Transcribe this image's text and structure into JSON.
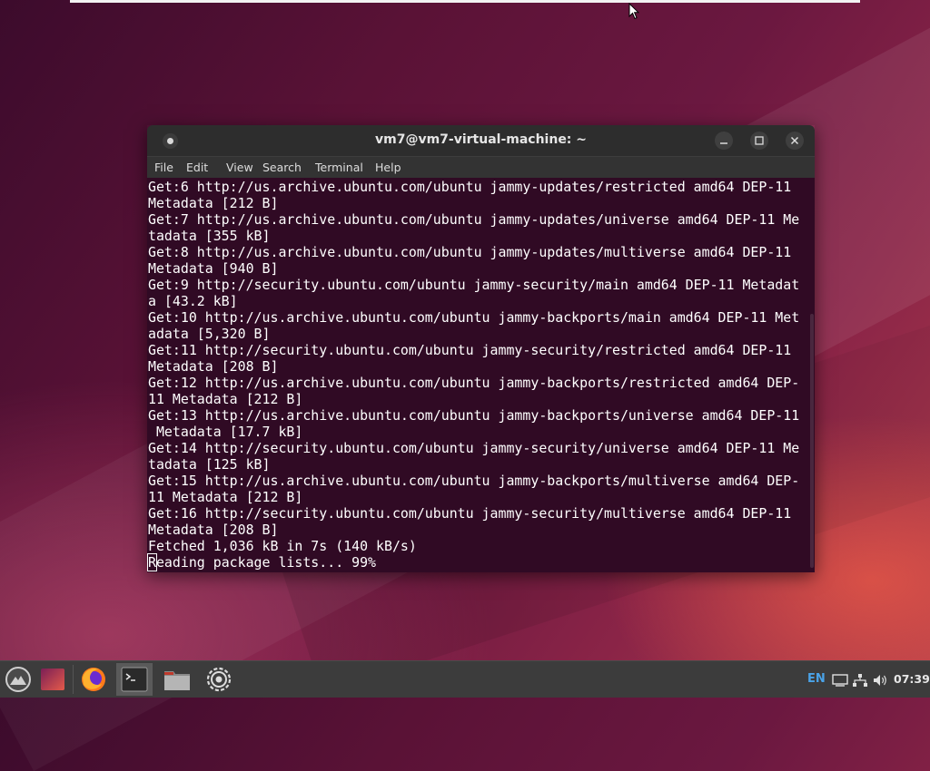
{
  "terminal": {
    "title": "vm7@vm7-virtual-machine: ~",
    "menu": [
      "File",
      "Edit",
      "View",
      "Search",
      "Terminal",
      "Help"
    ],
    "lines": [
      "Get:6 http://us.archive.ubuntu.com/ubuntu jammy-updates/restricted amd64 DEP-11",
      "Metadata [212 B]",
      "Get:7 http://us.archive.ubuntu.com/ubuntu jammy-updates/universe amd64 DEP-11 Me",
      "tadata [355 kB]",
      "Get:8 http://us.archive.ubuntu.com/ubuntu jammy-updates/multiverse amd64 DEP-11",
      "Metadata [940 B]",
      "Get:9 http://security.ubuntu.com/ubuntu jammy-security/main amd64 DEP-11 Metadat",
      "a [43.2 kB]",
      "Get:10 http://us.archive.ubuntu.com/ubuntu jammy-backports/main amd64 DEP-11 Met",
      "adata [5,320 B]",
      "Get:11 http://security.ubuntu.com/ubuntu jammy-security/restricted amd64 DEP-11",
      "Metadata [208 B]",
      "Get:12 http://us.archive.ubuntu.com/ubuntu jammy-backports/restricted amd64 DEP-",
      "11 Metadata [212 B]",
      "Get:13 http://us.archive.ubuntu.com/ubuntu jammy-backports/universe amd64 DEP-11",
      " Metadata [17.7 kB]",
      "Get:14 http://security.ubuntu.com/ubuntu jammy-security/universe amd64 DEP-11 Me",
      "tadata [125 kB]",
      "Get:15 http://us.archive.ubuntu.com/ubuntu jammy-backports/multiverse amd64 DEP-",
      "11 Metadata [212 B]",
      "Get:16 http://security.ubuntu.com/ubuntu jammy-security/multiverse amd64 DEP-11",
      "Metadata [208 B]",
      "Fetched 1,036 kB in 7s (140 kB/s)"
    ],
    "prompt_line": {
      "cursor_char": "R",
      "rest": "eading package lists... 99%"
    },
    "colors": {
      "background": "#300a24",
      "text": "#ffffff",
      "titlebar": "#2d2d2d"
    }
  },
  "taskbar": {
    "apps": [
      {
        "name": "app-menu",
        "icon": "mountain-logo-icon"
      },
      {
        "name": "show-desktop",
        "icon": "desktop-icon"
      },
      {
        "name": "firefox",
        "icon": "firefox-icon"
      },
      {
        "name": "terminal",
        "icon": "terminal-icon"
      },
      {
        "name": "files",
        "icon": "folder-icon"
      },
      {
        "name": "settings",
        "icon": "gear-icon"
      }
    ],
    "tray": {
      "language": "EN",
      "time": "07:39",
      "icons": [
        "display-icon",
        "network-icon",
        "volume-icon"
      ]
    },
    "colors": {
      "background": "#3c3c3c",
      "language": "#4aa3e8"
    }
  }
}
